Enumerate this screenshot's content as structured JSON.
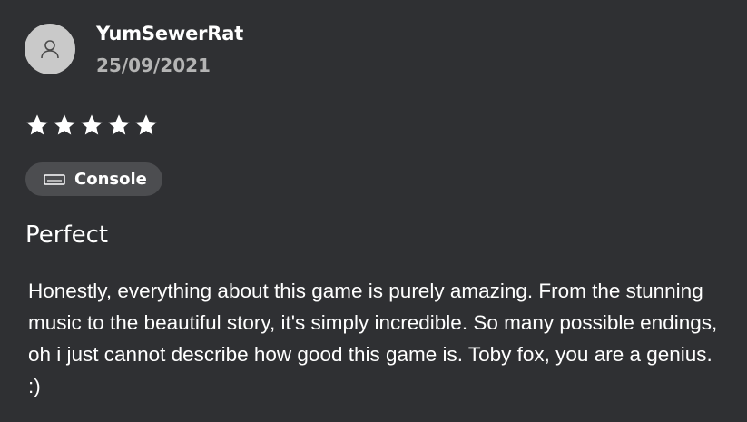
{
  "review": {
    "author": "YumSewerRat",
    "date": "25/09/2021",
    "rating": 5,
    "rating_max": 5,
    "platform": {
      "label": "Console",
      "icon": "console-icon"
    },
    "title": "Perfect",
    "body": "Honestly, everything about this game is purely amazing. From the stunning music to the beautiful story, it's simply incredible. So many possible endings, oh i just cannot describe how good this game is. Toby fox, you are a genius. :)"
  },
  "colors": {
    "background": "#2f3033",
    "avatar": "#c9c9c9",
    "chip": "#4c4d50",
    "date_text": "#b4b4b4",
    "text": "#ffffff"
  },
  "icons": {
    "avatar": "user-icon",
    "star": "star-icon"
  }
}
